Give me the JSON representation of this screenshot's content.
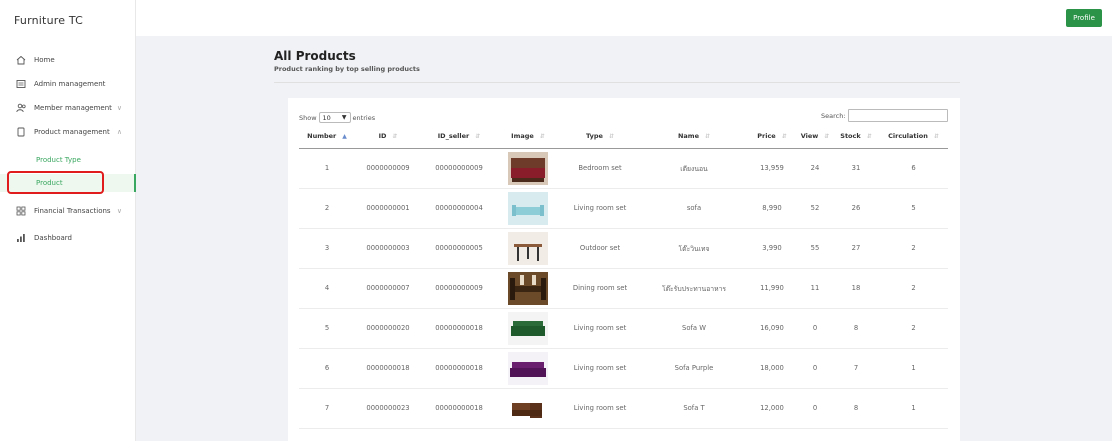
{
  "brand": "Furniture TC",
  "topbar": {
    "profile_label": "Profile"
  },
  "sidebar": {
    "items": [
      {
        "label": "Home"
      },
      {
        "label": "Admin management"
      },
      {
        "label": "Member management"
      },
      {
        "label": "Product management"
      },
      {
        "label": "Financial Transactions"
      },
      {
        "label": "Dashboard"
      }
    ],
    "sub_items": [
      {
        "label": "Product Type"
      },
      {
        "label": "Product"
      }
    ]
  },
  "page": {
    "title": "All Products",
    "subtitle": "Product ranking by top selling products"
  },
  "table_controls": {
    "show_label": "Show",
    "entries_value": "10",
    "entries_label": "entries",
    "search_label": "Search:"
  },
  "table": {
    "headers": [
      "Number",
      "ID",
      "ID_seller",
      "Image",
      "Type",
      "Name",
      "Price",
      "View",
      "Stock",
      "Circulation"
    ],
    "rows": [
      {
        "number": "1",
        "id": "0000000009",
        "seller": "00000000009",
        "type": "Bedroom set",
        "name": "เตียงนอน",
        "price": "13,959",
        "view": "24",
        "stock": "31",
        "circ": "6",
        "img": "bedroom"
      },
      {
        "number": "2",
        "id": "0000000001",
        "seller": "00000000004",
        "type": "Living room set",
        "name": "sofa",
        "price": "8,990",
        "view": "52",
        "stock": "26",
        "circ": "5",
        "img": "sofa-blue"
      },
      {
        "number": "3",
        "id": "0000000003",
        "seller": "00000000005",
        "type": "Outdoor set",
        "name": "โต๊ะวินเทจ",
        "price": "3,990",
        "view": "55",
        "stock": "27",
        "circ": "2",
        "img": "table-outdoor"
      },
      {
        "number": "4",
        "id": "0000000007",
        "seller": "00000000009",
        "type": "Dining room set",
        "name": "โต๊ะรับประทานอาหาร",
        "price": "11,990",
        "view": "11",
        "stock": "18",
        "circ": "2",
        "img": "dining"
      },
      {
        "number": "5",
        "id": "0000000020",
        "seller": "00000000018",
        "type": "Living room set",
        "name": "Sofa W",
        "price": "16,090",
        "view": "0",
        "stock": "8",
        "circ": "2",
        "img": "sofa-green"
      },
      {
        "number": "6",
        "id": "0000000018",
        "seller": "00000000018",
        "type": "Living room set",
        "name": "Sofa Purple",
        "price": "18,000",
        "view": "0",
        "stock": "7",
        "circ": "1",
        "img": "sofa-purple"
      },
      {
        "number": "7",
        "id": "0000000023",
        "seller": "00000000018",
        "type": "Living room set",
        "name": "Sofa T",
        "price": "12,000",
        "view": "0",
        "stock": "8",
        "circ": "1",
        "img": "sofa-brown"
      }
    ]
  },
  "colors": {
    "accent": "#2b9348",
    "highlight": "#e01c1c",
    "active_text": "#3aa760"
  }
}
